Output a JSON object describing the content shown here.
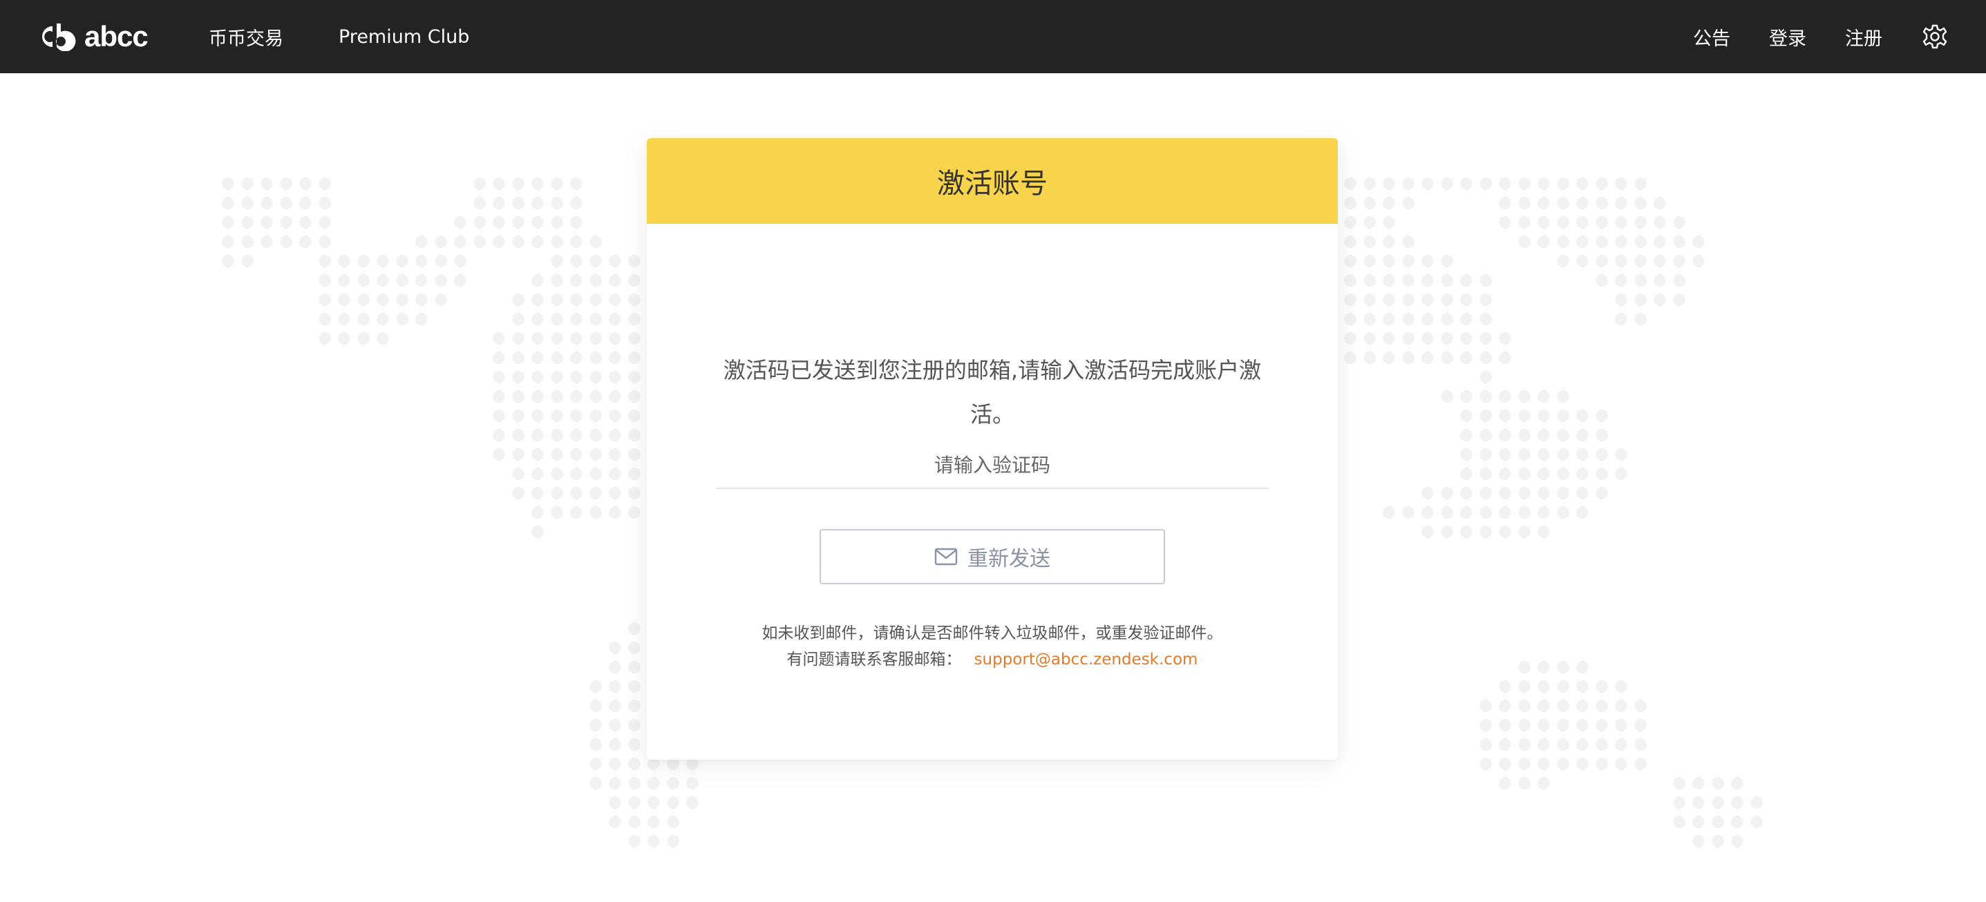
{
  "brand": {
    "logo_text": "abcc",
    "logo_icon": "abcc-logo-icon"
  },
  "nav": {
    "left_items": [
      {
        "label": "币币交易"
      },
      {
        "label": "Premium Club"
      }
    ],
    "right_items": [
      {
        "label": "公告"
      },
      {
        "label": "登录"
      },
      {
        "label": "注册"
      }
    ],
    "settings_icon": "gear-icon"
  },
  "card": {
    "title": "激活账号",
    "description": "激活码已发送到您注册的邮箱,请输入激活码完成账户激活。",
    "code_input": {
      "placeholder": "请输入验证码",
      "value": ""
    },
    "resend_button": {
      "label": "重新发送",
      "icon": "mail-icon"
    },
    "note_line1": "如未收到邮件，请确认是否邮件转入垃圾邮件，或重发验证邮件。",
    "note_line2_prefix": "有问题请联系客服邮箱：",
    "support_email": "support@abcc.zendesk.com"
  },
  "colors": {
    "topbar_bg": "#232323",
    "header_yellow": "#f7d44c",
    "link_orange": "#e27a28",
    "button_border": "#c8cbd3"
  }
}
